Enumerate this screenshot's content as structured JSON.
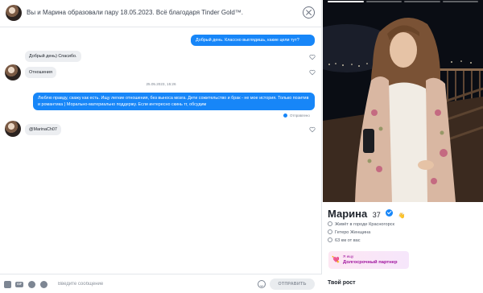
{
  "header": {
    "title": "Вы и Марина образовали пару 18.05.2023. Всё благодаря Tinder Gold™."
  },
  "messages": [
    {
      "id": "m1",
      "direction": "out",
      "text": "Добрый день. Классно выглядишь, какие цели тут?"
    },
    {
      "id": "m2",
      "direction": "in",
      "text": "Добрый день) Спасибо."
    },
    {
      "id": "m3",
      "direction": "in",
      "text": "Отношения"
    },
    {
      "id": "m4",
      "direction": "out",
      "text": "Люблю правду, скажу как есть. Ищу легкие отношения, без выноса мозга. Дети сожительство и брак - не мое история. Только позитив и романтика ) Морально-материально поддержу. Если интересно скинь тг, обсудим"
    },
    {
      "id": "m5",
      "direction": "in",
      "text": "@MarinaCh07"
    }
  ],
  "date_divider": "25.05.2023, 15:26",
  "status": "Отправлено",
  "composer": {
    "placeholder": "Введите сообщение",
    "send_label": "ОТПРАВИТЬ",
    "gif_label": "GIF"
  },
  "profile": {
    "name": "Марина",
    "age": "37",
    "wave": "👋",
    "location": "Живёт в городе Красногорск",
    "orientation": "Гетеро Женщина",
    "distance": "63 км от вас",
    "goal_label": "Я ищу",
    "goal_value": "Долгосрочный партнер",
    "goal_emoji": "💘",
    "section_title": "Твой рост",
    "photo_pages": 4,
    "active_photo": 1
  },
  "colors": {
    "accent": "#1786f8",
    "goal": "#a0149e"
  }
}
